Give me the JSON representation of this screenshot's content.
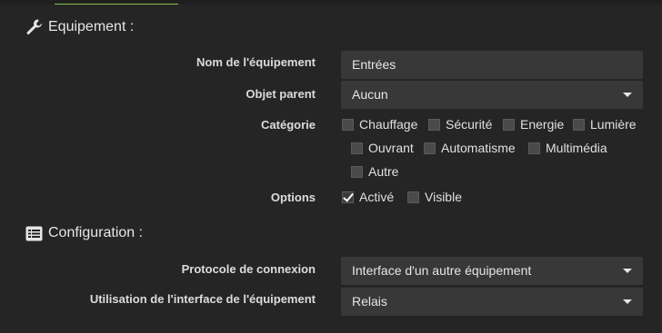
{
  "sections": {
    "equipement_title": "Equipement :",
    "configuration_title": "Configuration :"
  },
  "equipment": {
    "name_label": "Nom de l'équipement",
    "name_value": "Entrées",
    "parent_label": "Objet parent",
    "parent_value": "Aucun",
    "category_label": "Catégorie",
    "categories": [
      {
        "label": "Chauffage",
        "checked": false
      },
      {
        "label": "Sécurité",
        "checked": false
      },
      {
        "label": "Energie",
        "checked": false
      },
      {
        "label": "Lumière",
        "checked": false
      },
      {
        "label": "Ouvrant",
        "checked": false
      },
      {
        "label": "Automatisme",
        "checked": false
      },
      {
        "label": "Multimédia",
        "checked": false
      },
      {
        "label": "Autre",
        "checked": false
      }
    ],
    "options_label": "Options",
    "options": [
      {
        "label": "Activé",
        "checked": true
      },
      {
        "label": "Visible",
        "checked": false
      }
    ]
  },
  "configuration": {
    "protocol_label": "Protocole de connexion",
    "protocol_value": "Interface d'un autre équipement",
    "interface_label": "Utilisation de l'interface de l'équipement",
    "interface_value": "Relais"
  },
  "icons": {
    "equipement": "wrench-icon",
    "configuration": "list-icon"
  },
  "colors": {
    "background": "#252525",
    "field": "#383838",
    "accent": "#8bc34a"
  }
}
